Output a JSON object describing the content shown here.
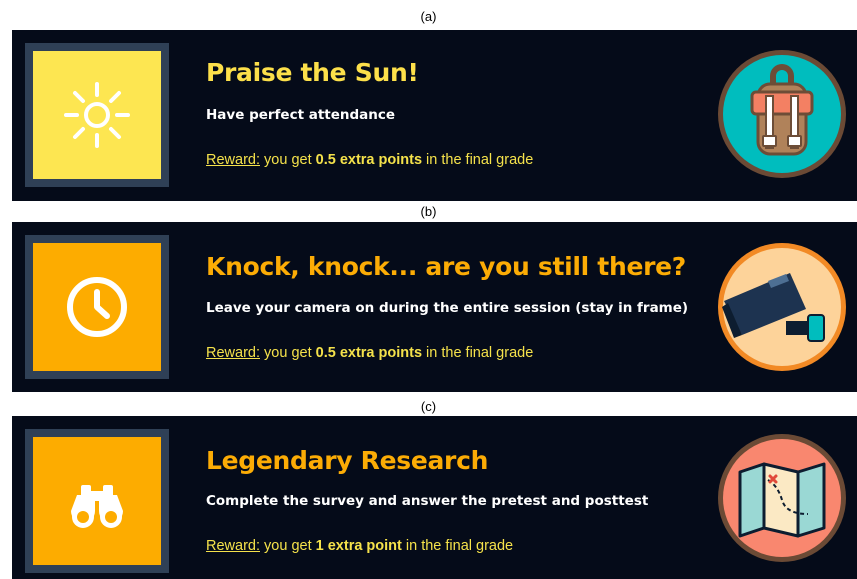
{
  "panels": [
    {
      "label": "(a)",
      "title": "Praise the Sun!",
      "description": "Have perfect attendance",
      "reward_label": "Reward:",
      "reward_pre": "you get",
      "reward_value": "0.5 extra points",
      "reward_post": "in the final grade",
      "badge_icon": "sun-icon",
      "medal_icon": "backpack-icon",
      "badge_color": "#fde651",
      "title_color": "#fde04a",
      "medal_color": "#00bdbe"
    },
    {
      "label": "(b)",
      "title": "Knock, knock... are you still there?",
      "description": "Leave your camera on during the entire session (stay in frame)",
      "reward_label": "Reward:",
      "reward_pre": "you get",
      "reward_value": "0.5 extra points",
      "reward_post": "in the final grade",
      "badge_icon": "clock-icon",
      "medal_icon": "security-camera-icon",
      "badge_color": "#fdac00",
      "title_color": "#fcac05",
      "medal_color": "#fdd39a"
    },
    {
      "label": "(c)",
      "title": "Legendary Research",
      "description": "Complete the survey and answer the pretest and posttest",
      "reward_label": "Reward:",
      "reward_pre": "you get",
      "reward_value": "1 extra point",
      "reward_post": "in the final grade",
      "badge_icon": "binoculars-icon",
      "medal_icon": "treasure-map-icon",
      "badge_color": "#fdac00",
      "title_color": "#fcac05",
      "medal_color": "#f9876f"
    }
  ],
  "colors": {
    "card_background": "#050b19",
    "badge_border": "#2f4056",
    "reward_text": "#f5e24b"
  }
}
